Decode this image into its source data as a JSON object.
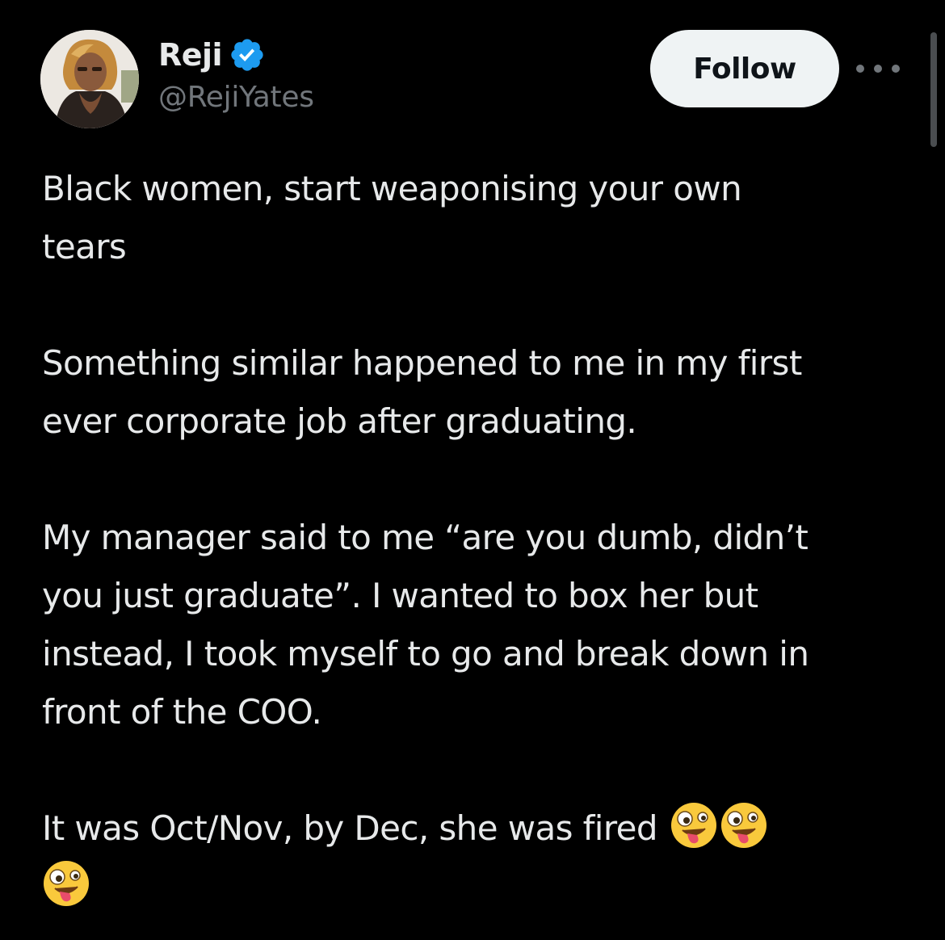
{
  "tweet": {
    "display_name": "Reji",
    "handle": "@RejiYates",
    "verified_icon": "verified-badge-icon",
    "follow_label": "Follow",
    "more_icon": "more-horizontal-icon",
    "paragraphs": [
      "Black women, start weaponising your own\ntears",
      "Something similar happened to me in my first\never corporate job after graduating.",
      "My manager said to me “are you dumb, didn’t\nyou just graduate”. I wanted to box her but\ninstead, I took myself to go and break down in\nfront of the COO."
    ],
    "last_paragraph_text": "It was Oct/Nov, by Dec, she was fired ",
    "last_paragraph_emojis": [
      "zany-face-icon",
      "zany-face-icon",
      "zany-face-icon"
    ]
  },
  "colors": {
    "background": "#000000",
    "text_primary": "#e7e9ea",
    "text_secondary": "#71767b",
    "verified_blue": "#1d9bf0",
    "follow_button_bg": "#eff3f4",
    "follow_button_text": "#0f1419"
  }
}
